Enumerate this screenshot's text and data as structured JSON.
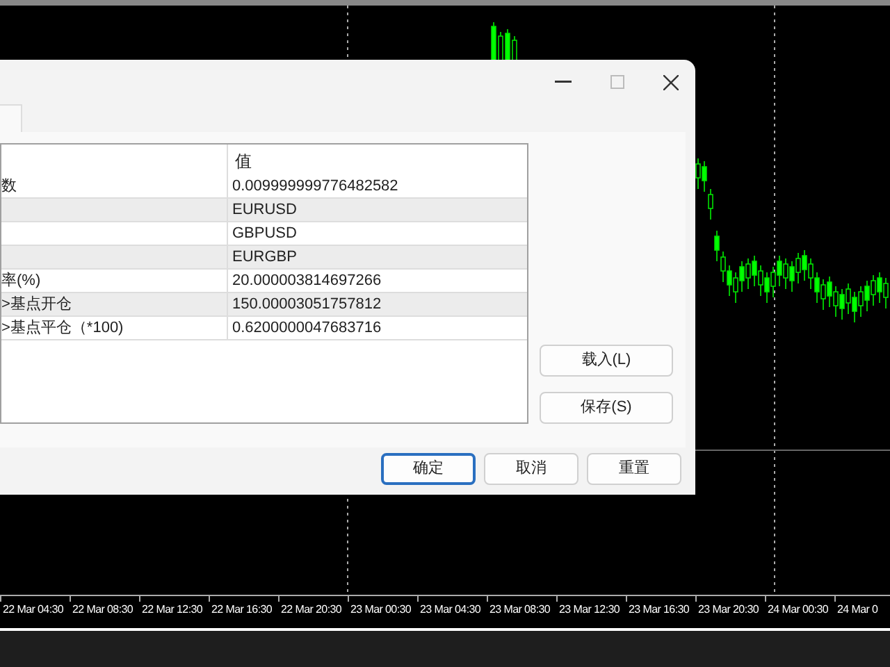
{
  "dialog": {
    "table": {
      "column_2": "值",
      "rows": [
        {
          "value": "0.009999999776482582",
          "name": "数"
        },
        {
          "value": "EURUSD"
        },
        {
          "value": "GBPUSD"
        },
        {
          "value": "EURGBP"
        },
        {
          "value": "20.000003814697266",
          "name": "率(%)"
        },
        {
          "value": "150.00003051757812",
          "name": ">基点开仓"
        },
        {
          "value": "0.6200000047683716",
          "name": ">基点平仓（*100)"
        }
      ]
    },
    "side_buttons": [
      "载入(L)",
      "保存(S)"
    ],
    "buttons": [
      {
        "label": "确定",
        "is_default": true
      },
      {
        "label": "取消",
        "is_default": false
      },
      {
        "label": "重置",
        "is_default": false
      }
    ]
  },
  "time_axis": [
    "22 Mar 04:30",
    "22 Mar 08:30",
    "22 Mar 12:30",
    "22 Mar 16:30",
    "22 Mar 20:30",
    "23 Mar 00:30",
    "23 Mar 04:30",
    "23 Mar 08:30",
    "23 Mar 12:30",
    "23 Mar 16:30",
    "23 Mar 20:30",
    "24 Mar 00:30",
    "24 Mar 0"
  ]
}
